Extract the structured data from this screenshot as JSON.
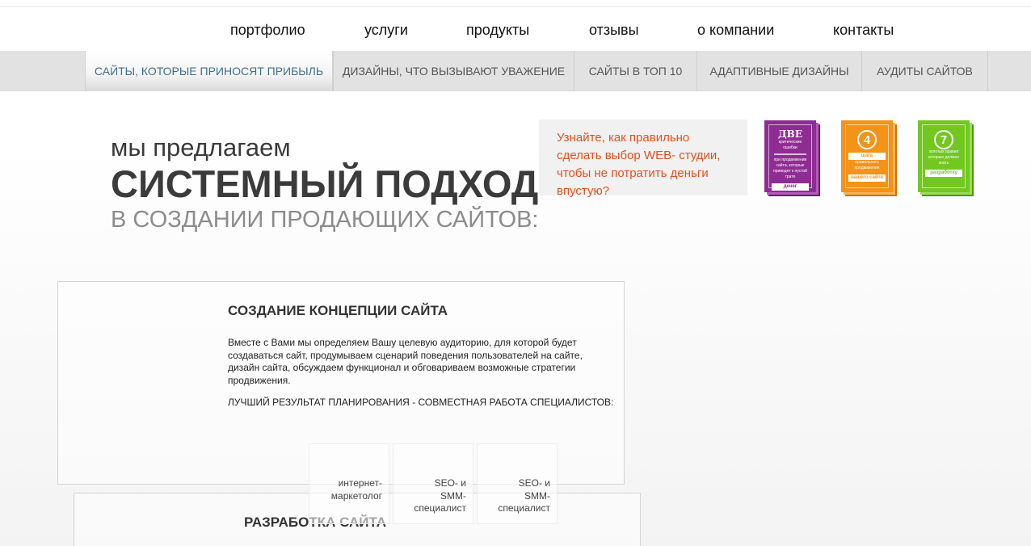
{
  "nav": {
    "items": [
      "портфолио",
      "услуги",
      "продукты",
      "отзывы",
      "о компании",
      "контакты"
    ]
  },
  "subnav": {
    "tabs": [
      {
        "label": "Сайты, которые приносят прибыль",
        "active": true
      },
      {
        "label": "Дизайны, что вызывают уважение",
        "active": false
      },
      {
        "label": "Сайты в ТОП 10",
        "active": false
      },
      {
        "label": "Адаптивные дизайны",
        "active": false
      },
      {
        "label": "Аудиты сайтов",
        "active": false
      }
    ]
  },
  "hero": {
    "line1": "мы предлагаем",
    "line2": "СИСТЕМНЫЙ ПОДХОД",
    "line3": "в создании продающих сайтов:"
  },
  "promo": {
    "text": "Узнайте, как правильно сделать выбор WEB- студии, чтобы не потратить деньги впустую?"
  },
  "books": [
    {
      "color": "#8f2c93",
      "icon": "book-cover-purple",
      "big": "ДВЕ",
      "small1": "критические ошибки",
      "small2": "при продвижении сайта, которые приводят к пустой трате",
      "ribbon": "денег"
    },
    {
      "color": "#f39318",
      "icon": "book-cover-orange",
      "num": "4",
      "small1": "шага",
      "small2": "правильного продвижения",
      "ribbon": "вашего сайта"
    },
    {
      "color": "#72c81f",
      "icon": "book-cover-green",
      "num": "7",
      "small1": "золотых правил",
      "small2": "которые должен знать",
      "ribbon": "разработку сайта"
    }
  ],
  "section1": {
    "title": "Создание концепции сайта",
    "text": "Вместе с Вами мы определяем Вашу целевую аудиторию, для которой будет создаваться сайт, продумываем сценарий поведения пользователей на сайте, дизайн сайта, обсуждаем функционал и обговариваем возможные стратегии продвижения.",
    "note": "Лучший результат планирования - совместная работа специалистов:"
  },
  "specialists": [
    {
      "line1": "интернет-",
      "line2": "маркетолог",
      "line3": ""
    },
    {
      "line1": "SEO- и",
      "line2": "SMM-",
      "line3": "специалист"
    },
    {
      "line1": "SEO- и",
      "line2": "SMM-",
      "line3": "специалист"
    }
  ],
  "section2": {
    "title": "Разработка сайта"
  }
}
